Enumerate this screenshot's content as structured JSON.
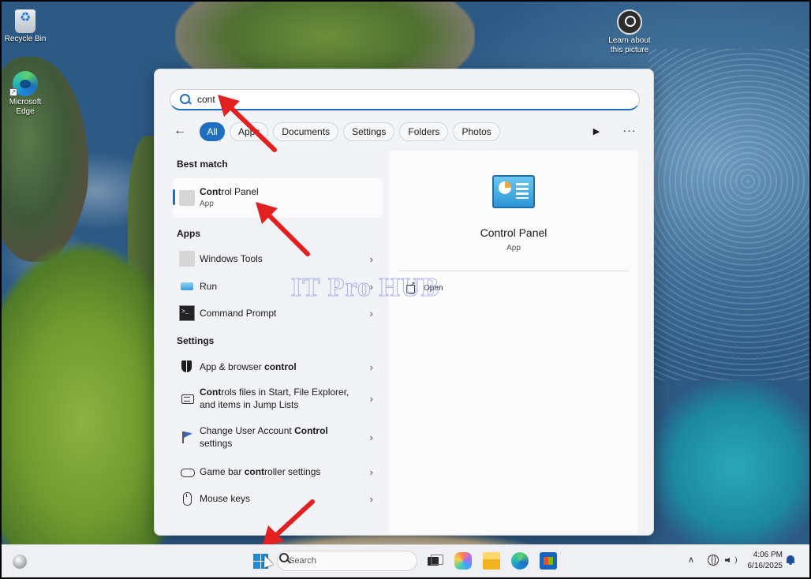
{
  "desktop": {
    "icons": [
      {
        "label": "Recycle Bin"
      },
      {
        "label": "Microsoft Edge"
      },
      {
        "label": "Learn about this picture"
      }
    ]
  },
  "search": {
    "query": "cont",
    "filters": [
      "All",
      "Apps",
      "Documents",
      "Settings",
      "Folders",
      "Photos"
    ],
    "active_filter": "All"
  },
  "results": {
    "best_match_title": "Best match",
    "best_match": {
      "name_bold": "Cont",
      "name_rest": "rol Panel",
      "sub": "App"
    },
    "apps_title": "Apps",
    "apps": [
      {
        "name": "Windows Tools",
        "icon": "windows-tools-icon"
      },
      {
        "name": "Run",
        "icon": "run-icon"
      },
      {
        "name": "Command Prompt",
        "icon": "command-prompt-icon"
      }
    ],
    "settings_title": "Settings",
    "settings": [
      {
        "pre": "App & browser ",
        "bold": "control",
        "post": "",
        "line2": "",
        "icon": "shield-icon"
      },
      {
        "pre": "",
        "bold": "Cont",
        "post": "rols files in Start, File Explorer,",
        "line2": "and items in Jump Lists",
        "icon": "window-icon"
      },
      {
        "pre": "Change User Account ",
        "bold": "Control",
        "post": "",
        "line2": "settings",
        "icon": "flag-icon"
      },
      {
        "pre": "Game bar ",
        "bold": "cont",
        "post": "roller settings",
        "line2": "",
        "icon": "gamepad-icon"
      },
      {
        "pre": "Mouse keys",
        "bold": "",
        "post": "",
        "line2": "",
        "icon": "mouse-icon"
      }
    ]
  },
  "details": {
    "title": "Control Panel",
    "subtitle": "App",
    "action_open": "Open"
  },
  "watermark": "IT Pro HUB",
  "taskbar": {
    "search_label": "Search",
    "time": "4:06 PM",
    "date": "6/16/2025"
  },
  "colors": {
    "accent": "#1f6fc0",
    "arrow": "#e32020"
  }
}
